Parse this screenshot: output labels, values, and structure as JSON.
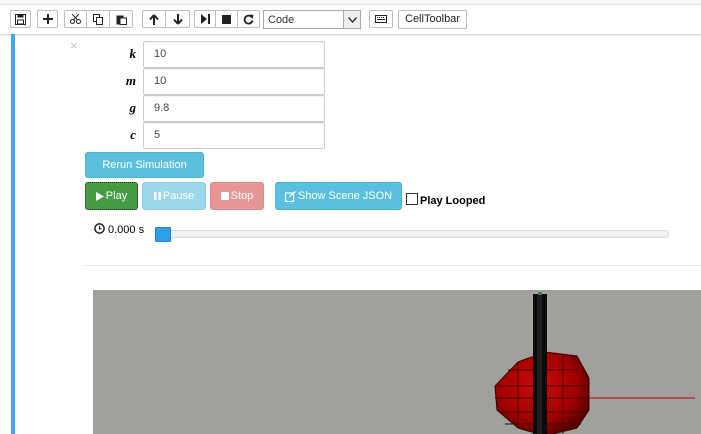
{
  "toolbar": {
    "buttons": [
      "save-icon",
      "plus-icon",
      "cut-icon",
      "copy-icon",
      "paste-icon",
      "arrow-up-icon",
      "arrow-down-icon",
      "step-forward-icon",
      "stop-icon",
      "refresh-icon"
    ],
    "cell_type": "Code",
    "keyboard_icon": "keyboard-icon",
    "cell_toolbar_label": "CellToolbar"
  },
  "cell": {
    "close_glyph": "×",
    "params": [
      {
        "label": "k",
        "value": "10"
      },
      {
        "label": "m",
        "value": "10"
      },
      {
        "label": "g",
        "value": "9.8"
      },
      {
        "label": "c",
        "value": "5"
      }
    ],
    "rerun_label": "Rerun Simulation",
    "play_label": "Play",
    "pause_label": "Pause",
    "stop_label": "Stop",
    "json_label": "Show Scene JSON",
    "loop_label": "Play Looped",
    "time_readout": "0.000 s",
    "progress": 0
  },
  "colors": {
    "accent": "#42a5f5",
    "play": "#449d44",
    "info": "#5bc0de",
    "stop": "#e79693",
    "scene_bg": "#a0a09c",
    "ball": "#b00000"
  }
}
